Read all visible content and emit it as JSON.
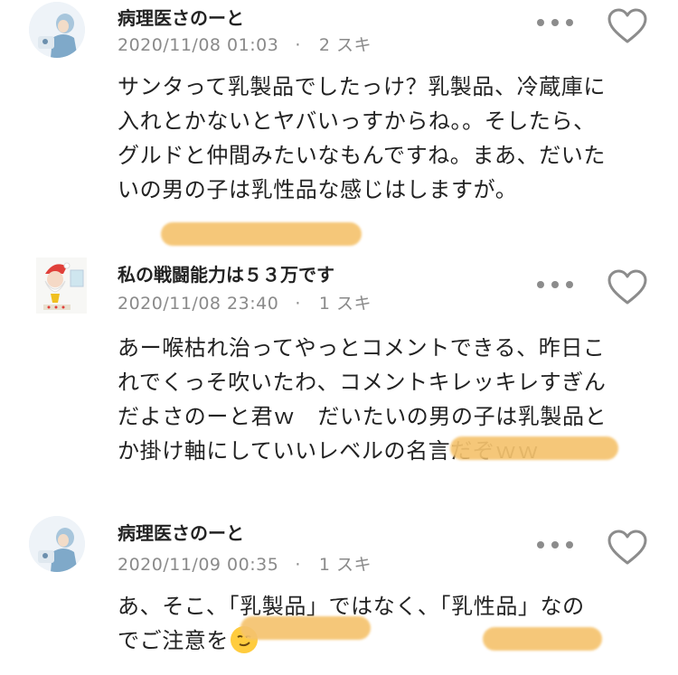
{
  "comments": [
    {
      "author": "病理医さのーと",
      "date": "2020/11/08 01:03",
      "likes": "2 スキ",
      "text": "サンタって乳製品でしたっけ？乳製品、冷蔵庫に\n入れとかないとヤバいっすからね。。そしたら、\nグルドと仲間みたいなもんですね。まあ、だいた\nいの男の子は乳性品な感じはしますが。"
    },
    {
      "author": "私の戦闘能力は５３万です",
      "date": "2020/11/08 23:40",
      "likes": "1 スキ",
      "text": "あー喉枯れ治ってやっとコメントできる、昨日こ\nれでくっそ吹いたわ、コメントキレッキレすぎん\nだよさのーと君ｗ　だいたいの男の子は乳製品と\nか掛け軸にしていいレベルの名言だぞｗｗ"
    },
    {
      "author": "病理医さのーと",
      "date": "2020/11/09 00:35",
      "likes": "1 スキ",
      "text": "あ、そこ、「乳製品」ではなく、「乳性品」なの\nでご注意を"
    }
  ],
  "meta_separator": "·",
  "icons": {
    "more": "more-dots-icon",
    "like": "heart-outline-icon",
    "emoji": "smirking-face-emoji"
  },
  "colors": {
    "highlight": "#f5c36e",
    "meta": "#8a8a8a",
    "icon": "#8c8c8c"
  }
}
